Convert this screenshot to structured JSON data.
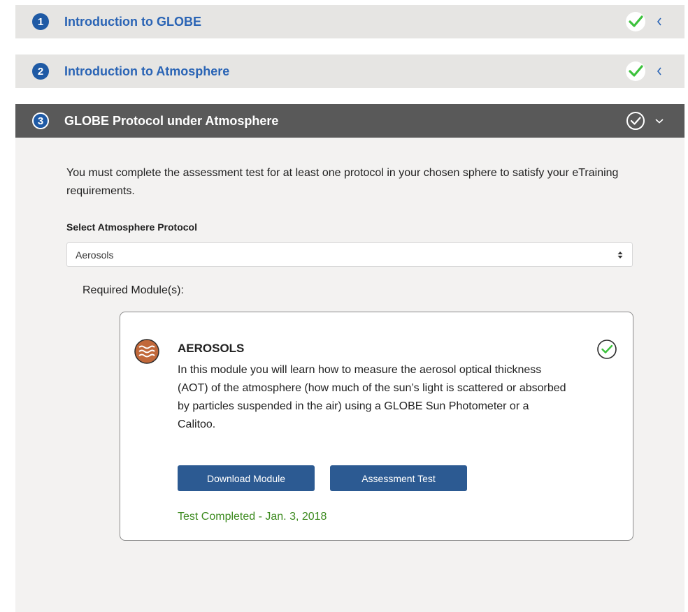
{
  "sections": [
    {
      "number": "1",
      "title": "Introduction to GLOBE",
      "state": "collapsed",
      "completed": true
    },
    {
      "number": "2",
      "title": "Introduction to Atmosphere",
      "state": "collapsed",
      "completed": true
    },
    {
      "number": "3",
      "title": "GLOBE Protocol under Atmosphere",
      "state": "expanded",
      "completed": true
    }
  ],
  "panel": {
    "intro_text": "You must complete the assessment test for at least one protocol in your chosen sphere to satisfy your eTraining requirements.",
    "select_label": "Select Atmosphere Protocol",
    "select_value": "Aerosols",
    "required_label": "Required Module(s):"
  },
  "module": {
    "icon": "aerosols-waves-icon",
    "title": "AEROSOLS",
    "description": "In this module you will learn how to measure the aerosol optical thickness (AOT) of the atmosphere (how much of the sun’s light is scattered or absorbed by particles suspended in the air) using a GLOBE Sun Photometer or a Calitoo.",
    "download_label": "Download Module",
    "assessment_label": "Assessment Test",
    "status": "Test Completed - Jan. 3, 2018"
  },
  "colors": {
    "badge_blue": "#1f5aa5",
    "link_blue": "#2a64b5",
    "check_green": "#3cc23c",
    "button_blue": "#2c5a92",
    "status_green": "#3c8a1f",
    "expanded_header": "#595959",
    "collapsed_header": "#e6e5e3",
    "aerosol_icon": "#c1683a"
  }
}
